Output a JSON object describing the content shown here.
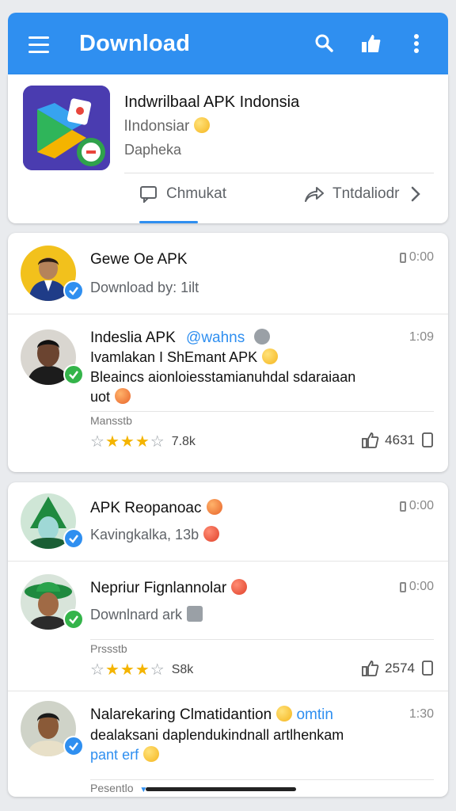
{
  "appbar": {
    "title": "Download",
    "icons": [
      "menu-icon",
      "search-icon",
      "thumbs-up-icon",
      "more-vert-icon"
    ]
  },
  "featured": {
    "title": "Indwrilbaal APK Indonsia",
    "subtitle": "lIndonsiar",
    "subtitle2": "Dapheka",
    "action_left": "Chmukat",
    "action_right": "Tntdaliodr",
    "icon": "play-store-app-icon"
  },
  "list1": [
    {
      "name": "Gewe Oe APK",
      "sub": "Download by: 1ilt",
      "time": "0:00",
      "badge": "blue"
    },
    {
      "name": "Indeslia APK",
      "tag": "@wahns",
      "line1": "Ivamlakan I ShEmant APK",
      "line2": "Bleaincs aionloiesstamianuhdal sdaraiaan",
      "line3": "uot",
      "time": "1:09",
      "badge": "green",
      "meta_label": "Mansstb",
      "rating": 3.5,
      "rating_count": "7.8k",
      "likes": "4631"
    }
  ],
  "list2": [
    {
      "name": "APK Reopanoac",
      "sub": "Kavingkalka, 13b",
      "time": "0:00",
      "badge": "blue"
    },
    {
      "name": "Nepriur Fignlannolar",
      "sub": "Downlnard ark",
      "time": "0:00",
      "badge": "green",
      "meta_label": "Prssstb",
      "rating": 3.5,
      "rating_count": "S8k",
      "likes": "2574"
    },
    {
      "name": "Nalarekaring Clmatidantion",
      "tag": "omtin",
      "line1": "dealaksani daplendukindnall artlhenkam",
      "line2a": "pant",
      "line2b": "erf",
      "time": "1:30",
      "badge": "blue",
      "meta_label": "Pesentlo"
    }
  ]
}
